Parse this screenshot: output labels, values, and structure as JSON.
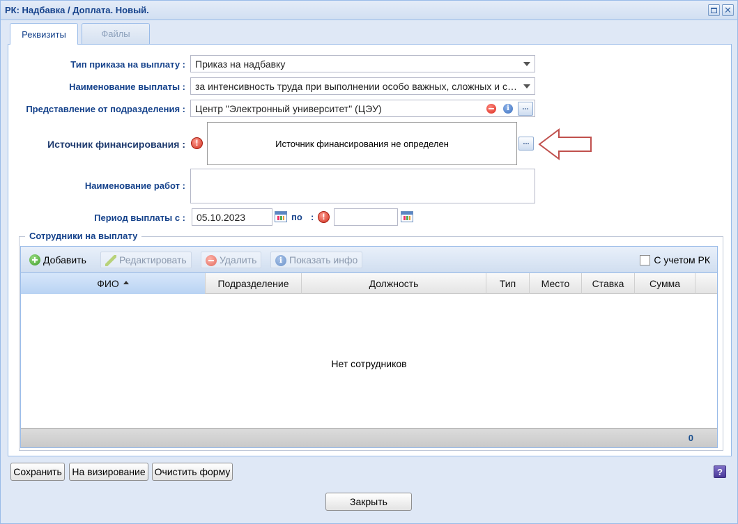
{
  "window": {
    "title": "РК: Надбавка / Доплата. Новый.",
    "maximize_icon": "maximize-icon",
    "close_icon": "close-icon"
  },
  "tabs": [
    {
      "label": "Реквизиты",
      "active": true
    },
    {
      "label": "Файлы",
      "active": false
    }
  ],
  "form": {
    "order_type": {
      "label": "Тип приказа на выплату :",
      "value": "Приказ на надбавку"
    },
    "payment_name": {
      "label": "Наименование выплаты :",
      "value": "за интенсивность труда при выполнении особо важных, сложных и срочных работ"
    },
    "department": {
      "label": "Представление от подразделения :",
      "value": "Центр \"Электронный университет\" (ЦЭУ)"
    },
    "funding_source": {
      "label": "Источник финансирования :",
      "value": "Источник финансирования не определен"
    },
    "works_name": {
      "label": "Наименование работ :",
      "value": ""
    },
    "period": {
      "label_from": "Период выплаты с :",
      "from_value": "05.10.2023",
      "label_to": "по",
      "label_to_colon": ":",
      "to_value": ""
    }
  },
  "employees": {
    "legend": "Сотрудники на выплату",
    "toolbar": {
      "add": "Добавить",
      "edit": "Редактировать",
      "delete": "Удалить",
      "info": "Показать инфо",
      "with_rk": "С учетом РК"
    },
    "columns": [
      "ФИО",
      "Подразделение",
      "Должность",
      "Тип",
      "Место",
      "Ставка",
      "Сумма"
    ],
    "empty_text": "Нет сотрудников",
    "total": "0"
  },
  "buttons": {
    "save": "Сохранить",
    "approve": "На визирование",
    "clear": "Очистить форму",
    "close": "Закрыть",
    "help_glyph": "?"
  },
  "colors": {
    "accent": "#15428b",
    "annotation_arrow": "#c0504d"
  }
}
